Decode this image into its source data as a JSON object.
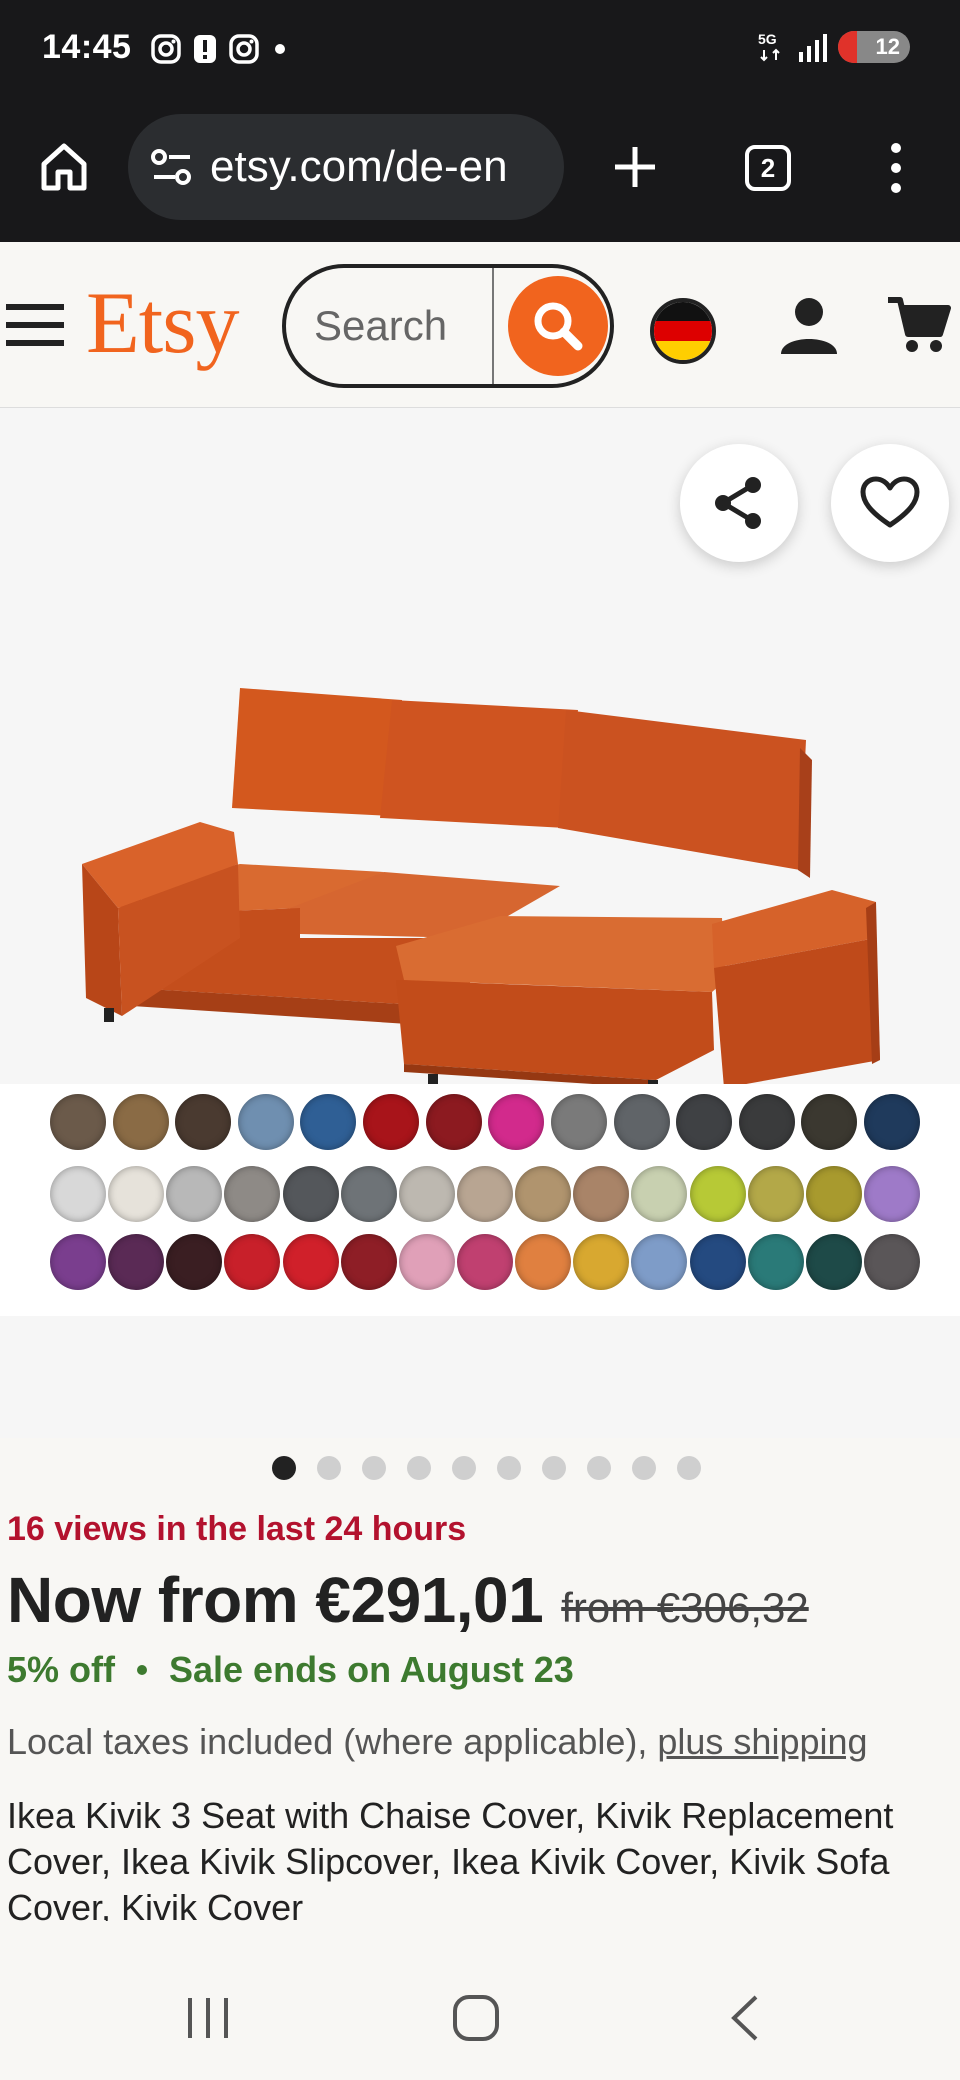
{
  "status_bar": {
    "time": "14:45",
    "network": "5G",
    "battery": "12"
  },
  "browser": {
    "url": "etsy.com/de-en",
    "tab_count": "2"
  },
  "header": {
    "logo": "Etsy",
    "search_placeholder": "Search"
  },
  "gallery": {
    "image_count": 10,
    "active_index": 0,
    "swatch_colors": [
      [
        "#6b5a4a",
        "#8a6b45",
        "#4a3a30",
        "#6f8fb0",
        "#2f5f95",
        "#a8141a",
        "#8c1a20",
        "#d22a8c",
        "#7a7a7a",
        "#606468",
        "#3f4144",
        "#3a3b3c",
        "#3b3830",
        "#1f3a5c"
      ],
      [
        "#d8d8d8",
        "#e6e2da",
        "#b8b8b8",
        "#8e8a86",
        "#54575b",
        "#6e7377",
        "#bdb8b0",
        "#b8a592",
        "#b0946e",
        "#a98468",
        "#c8d0b0",
        "#b7c936",
        "#b3a848",
        "#a89a2e",
        "#9e7ac8"
      ],
      [
        "#7a3e8e",
        "#5a2a55",
        "#3a1e22",
        "#c8202a",
        "#d0202a",
        "#8e1e26",
        "#e0a0b8",
        "#c04070",
        "#e08040",
        "#d8a830",
        "#7e9cc8",
        "#244a80",
        "#2a7a78",
        "#1e4a48",
        "#5a5658"
      ]
    ]
  },
  "product": {
    "views": "16 views in the last 24 hours",
    "price": "Now from €291,01",
    "old_price": "from €306,32",
    "discount": "5% off",
    "sale_end": "Sale ends on August 23",
    "taxes": "Local taxes included (where applicable),",
    "shipping_link": "plus shipping",
    "title": "Ikea Kivik 3 Seat with Chaise Cover, Kivik Replacement Cover, Ikea Kivik Slipcover, Ikea Kivik Cover, Kivik Sofa Cover, Kivik Cover"
  }
}
